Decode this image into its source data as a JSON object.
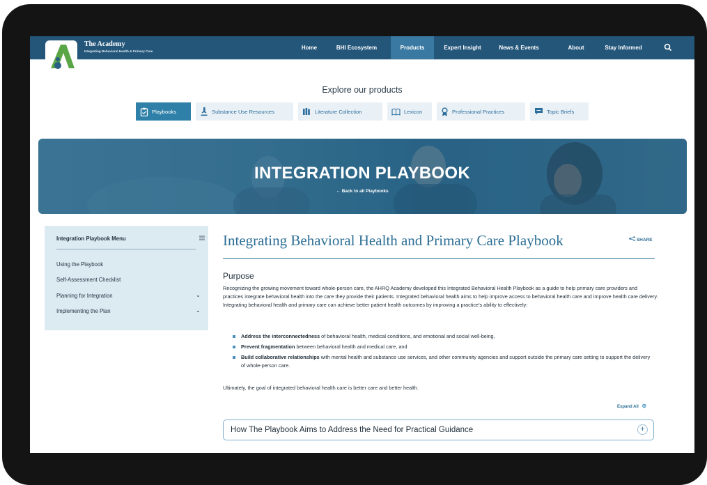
{
  "brand": {
    "name": "The Academy",
    "tagline": "Integrating Behavioral Health & Primary Care"
  },
  "nav": {
    "items": [
      {
        "label": "Home"
      },
      {
        "label": "BHI Ecosystem"
      },
      {
        "label": "Products",
        "active": true
      },
      {
        "label": "Expert Insight"
      },
      {
        "label": "News & Events"
      },
      {
        "label": "About"
      },
      {
        "label": "Stay Informed"
      }
    ],
    "search_icon": "search-icon"
  },
  "explore": {
    "title": "Explore our products",
    "tabs": [
      {
        "label": "Playbooks",
        "icon": "clipboard-icon",
        "active": true
      },
      {
        "label": "Substance Use Resources",
        "icon": "microscope-icon"
      },
      {
        "label": "Literature Collection",
        "icon": "books-icon"
      },
      {
        "label": "Lexicon",
        "icon": "book-icon"
      },
      {
        "label": "Professional Practices",
        "icon": "award-icon"
      },
      {
        "label": "Topic Briefs",
        "icon": "chat-icon"
      }
    ]
  },
  "banner": {
    "title": "INTEGRATION PLAYBOOK",
    "back_link": "← Back to all Playbooks"
  },
  "sidebar": {
    "title": "Integration Playbook Menu",
    "items": [
      {
        "label": "Using the Playbook",
        "has_children": false
      },
      {
        "label": "Self-Assessment Checklist",
        "has_children": false
      },
      {
        "label": "Planning for Integration",
        "has_children": true
      },
      {
        "label": "Implementing the Plan",
        "has_children": true
      }
    ]
  },
  "main": {
    "heading": "Integrating Behavioral Health and Primary Care Playbook",
    "share_label": "SHARE",
    "purpose_heading": "Purpose",
    "purpose_text": "Recognizing the growing movement toward whole-person care, the AHRQ Academy developed this Integrated Behavioral Health Playbook as a guide to help primary care providers and practices integrate behavioral health into the care they provide their patients. Integrated behavioral health aims to help improve access to behavioral health care and improve health care delivery. Integrating behavioral health and primary care can achieve better patient health outcomes by improving a practice's ability to effectively:",
    "bullets": [
      {
        "bold": "Address the interconnectedness",
        "rest": " of behavioral health, medical conditions, and emotional and social well-being,"
      },
      {
        "bold": "Prevent fragmentation",
        "rest": " between behavioral health and medical care, and"
      },
      {
        "bold": "Build collaborative relationships",
        "rest": " with mental health and substance use services, and other community agencies and support outside the primary care setting to support the delivery of whole-person care."
      }
    ],
    "ultimately": "Ultimately, the goal of integrated behavioral health care is better care and better health.",
    "expand_all": "Expand All",
    "accordion": {
      "title": "How The Playbook Aims to Address the Need for Practical Guidance"
    }
  }
}
